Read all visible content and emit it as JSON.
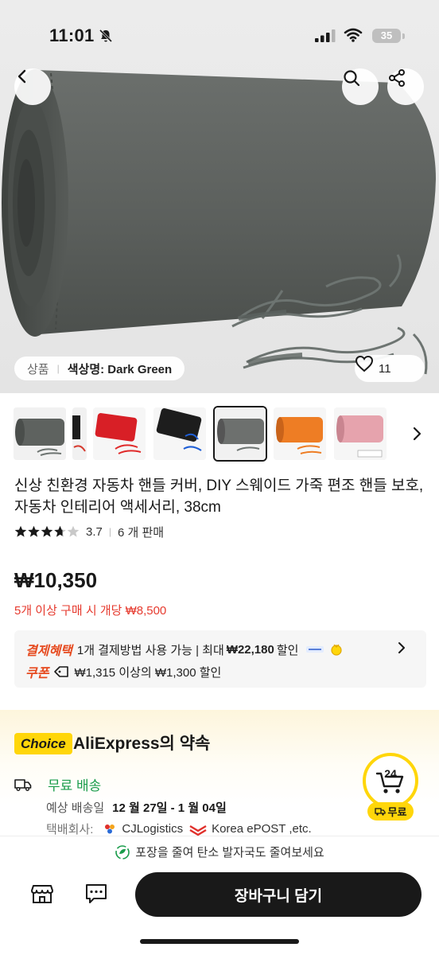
{
  "status_bar": {
    "time": "11:01",
    "battery": "35"
  },
  "hero": {
    "color_category": "상품",
    "color_label": "색상명: Dark Green",
    "like_count": "11",
    "icons": [
      "chevron-left-icon",
      "search-icon",
      "share-icon",
      "heart-icon"
    ]
  },
  "thumbnails": [
    {
      "name": "dark-green-roll",
      "color": "#5e625f"
    },
    {
      "name": "partial-red",
      "color": "#d63b2f"
    },
    {
      "name": "red-cover",
      "color": "#d81f26"
    },
    {
      "name": "black-cover",
      "color": "#1d1d1d"
    },
    {
      "name": "dark-gray-cover",
      "color": "#6d706e",
      "selected": true
    },
    {
      "name": "orange-cover",
      "color": "#ee7d24"
    },
    {
      "name": "pink-cover",
      "color": "#e6a3ad"
    }
  ],
  "product": {
    "title": "신상 친환경 자동차 핸들 커버, DIY 스웨이드 가죽 편조 핸들 보호, 자동차 인테리어 액세서리, 38cm",
    "rating": "3.7",
    "sold": "6 개 판매",
    "price": "₩10,350",
    "bulk_price": "5개 이상 구매 시 개당 ₩8,500"
  },
  "promo": {
    "payment_tag": "결제혜택",
    "payment_pre": "1개 결제방법 사용 가능 | 최대",
    "payment_amount": "₩22,180",
    "payment_post": "할인",
    "coupon_tag": "쿠폰",
    "coupon_text": "₩1,315 이상의 ₩1,300 할인"
  },
  "choice": {
    "badge": "Choice",
    "title": "AliExpress의 약속",
    "free_shipping": "무료 배송",
    "eta_label": "예상 배송일",
    "eta_value": "12 월 27일 - 1 월 04일",
    "carrier_label": "택배회사:",
    "carrier_1": "CJLogistics",
    "carrier_2": "Korea ePOST ,etc.",
    "badge24_text": "24",
    "badge24_label": "무료"
  },
  "eco_text": "포장을 줄여 탄소 발자국도 줄여보세요",
  "bottom": {
    "cart_label": "장바구니 담기"
  }
}
